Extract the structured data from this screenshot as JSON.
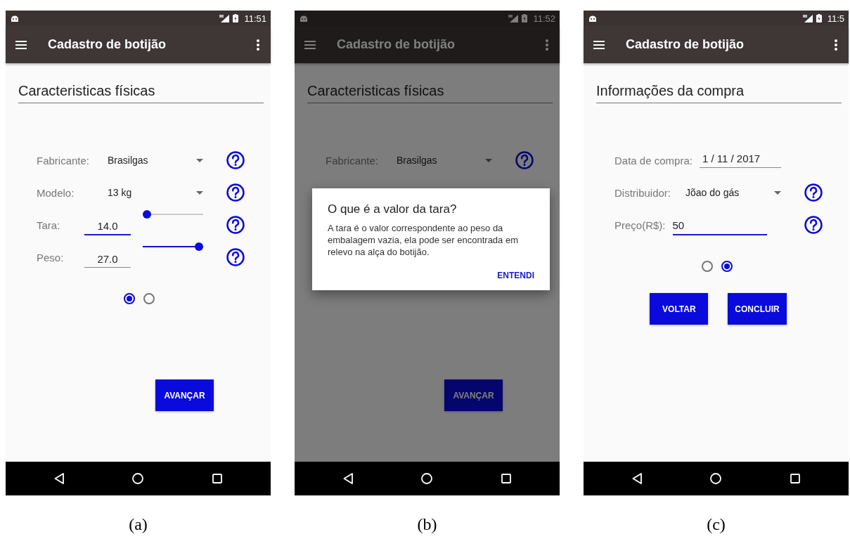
{
  "screens": [
    {
      "status_time": "11:51",
      "title": "Cadastro de botijão",
      "dimmed": false,
      "section_title": "Caracteristicas físicas",
      "rows": [
        {
          "kind": "dropdown",
          "label": "Fabricante:",
          "value": "Brasilgas",
          "help": true
        },
        {
          "kind": "dropdown",
          "label": "Modelo:",
          "value": "13 kg",
          "help": true
        },
        {
          "kind": "slider",
          "label": "Tara:",
          "value": "14.0",
          "focused": true,
          "level": 0,
          "help": true
        },
        {
          "kind": "slider",
          "label": "Peso:",
          "value": "27.0",
          "focused": false,
          "level": 1,
          "help": true
        }
      ],
      "pager": [
        {
          "selected": true
        },
        {
          "selected": false
        }
      ],
      "buttons": [
        "AVANÇAR"
      ],
      "caption": "(a)"
    },
    {
      "status_time": "11:52",
      "title": "Cadastro de botijão",
      "dimmed": true,
      "section_title": "Caracteristicas físicas",
      "rows": [
        {
          "kind": "dropdown",
          "label": "Fabricante:",
          "value": "Brasilgas",
          "help": true
        }
      ],
      "dialog": {
        "title": "O que é a valor da tara?",
        "body": "A tara é o valor correspondente ao peso da embalagem vazia, ela pode ser encontrada em relevo na alça do botijão.",
        "action": "ENTENDI"
      },
      "buttons": [
        "AVANÇAR"
      ],
      "caption": "(b)"
    },
    {
      "status_time": "11:5",
      "title": "Cadastro de botijão",
      "dimmed": false,
      "section_title": "Informações da compra",
      "rows": [
        {
          "kind": "date",
          "label": "Data de compra:",
          "value": "1 / 11 / 2017",
          "help": false
        },
        {
          "kind": "dropdown",
          "label": "Distribuidor:",
          "value": "Jõao do gás",
          "help": true
        },
        {
          "kind": "text",
          "label": "Preço(R$):",
          "value": "50",
          "focused": true,
          "help": true
        }
      ],
      "pager": [
        {
          "selected": false
        },
        {
          "selected": true
        }
      ],
      "buttons": [
        "VOLTAR",
        "CONCLUIR"
      ],
      "caption": "(c)"
    }
  ]
}
